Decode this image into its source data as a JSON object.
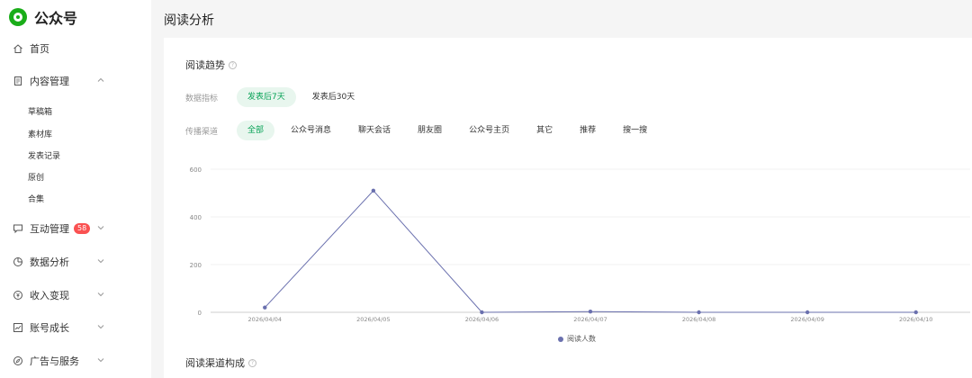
{
  "app": {
    "name": "公众号"
  },
  "sidebar": {
    "home": "首页",
    "content": {
      "label": "内容管理",
      "subitems": [
        "草稿箱",
        "素材库",
        "发表记录",
        "原创",
        "合集"
      ]
    },
    "interaction": {
      "label": "互动管理",
      "badge": "58"
    },
    "data_analysis": "数据分析",
    "revenue": "收入变现",
    "growth": "账号成长",
    "ads": "广告与服务"
  },
  "page": {
    "title": "阅读分析"
  },
  "reading_trend": {
    "title": "阅读趋势",
    "help": "?",
    "metric_label": "数据指标",
    "metric_options": [
      "发表后7天",
      "发表后30天"
    ],
    "metric_selected": 0,
    "channel_label": "传播渠道",
    "channel_options": [
      "全部",
      "公众号消息",
      "聊天会话",
      "朋友圈",
      "公众号主页",
      "其它",
      "推荐",
      "搜一搜"
    ],
    "channel_selected": 0
  },
  "chart_data": {
    "type": "line",
    "x": [
      "2026/04/04",
      "2026/04/05",
      "2026/04/06",
      "2026/04/07",
      "2026/04/08",
      "2026/04/09",
      "2026/04/10"
    ],
    "series": [
      {
        "name": "阅读人数",
        "values": [
          20,
          510,
          0,
          3,
          0,
          0,
          0
        ],
        "color": "#6a70ae"
      }
    ],
    "yticks": [
      0,
      200,
      400,
      600
    ],
    "ylim": [
      0,
      600
    ],
    "grid": true,
    "legend": "bottom"
  },
  "channel_composition": {
    "title": "阅读渠道构成",
    "help": "?"
  }
}
